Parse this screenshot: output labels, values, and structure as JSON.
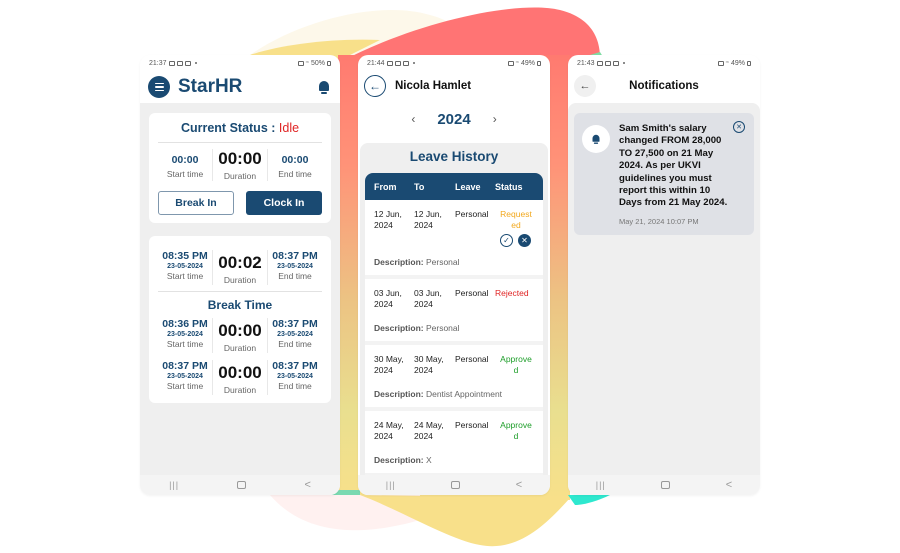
{
  "colors": {
    "brand": "#1a4a72",
    "idle": "#e02424",
    "requested": "#f2a81d",
    "rejected": "#e02424",
    "approved": "#1e9e2a"
  },
  "phone1": {
    "statusbar": {
      "time": "21:37",
      "battery": "50%"
    },
    "app_title": "StarHR",
    "menu_icon": "menu-icon",
    "bell_icon": "bell-icon",
    "current_status": {
      "label": "Current Status : ",
      "value": "Idle"
    },
    "timer": {
      "start_value": "00:00",
      "start_label": "Start time",
      "duration_value": "00:00",
      "duration_label": "Duration",
      "end_value": "00:00",
      "end_label": "End time"
    },
    "buttons": {
      "break_in": "Break In",
      "clock_in": "Clock In"
    },
    "session": {
      "start_time": "08:35 PM",
      "start_date": "23-05-2024",
      "start_label": "Start time",
      "duration": "00:02",
      "duration_label": "Duration",
      "end_time": "08:37 PM",
      "end_date": "23-05-2024",
      "end_label": "End time"
    },
    "break_title": "Break Time",
    "breaks": [
      {
        "start_time": "08:36 PM",
        "start_date": "23-05-2024",
        "start_label": "Start time",
        "duration": "00:00",
        "duration_label": "Duration",
        "end_time": "08:37 PM",
        "end_date": "23-05-2024",
        "end_label": "End time"
      },
      {
        "start_time": "08:37 PM",
        "start_date": "23-05-2024",
        "start_label": "Start time",
        "duration": "00:00",
        "duration_label": "Duration",
        "end_time": "08:37 PM",
        "end_date": "23-05-2024",
        "end_label": "End time"
      }
    ]
  },
  "phone2": {
    "statusbar": {
      "time": "21:44",
      "battery": "49%"
    },
    "employee_name": "Nicola Hamlet",
    "year": "2024",
    "section_title": "Leave History",
    "columns": [
      "From",
      "To",
      "Leave",
      "Status"
    ],
    "description_label": "Description:",
    "rows": [
      {
        "from": [
          "12 Jun,",
          "2024"
        ],
        "to": [
          "12 Jun,",
          "2024"
        ],
        "leave": "Personal",
        "status": [
          "Request",
          "ed"
        ],
        "status_kind": "requested",
        "description": "Personal",
        "actions": true
      },
      {
        "from": [
          "03 Jun,",
          "2024"
        ],
        "to": [
          "03 Jun,",
          "2024"
        ],
        "leave": "Personal",
        "status": [
          "Rejected",
          ""
        ],
        "status_kind": "rejected",
        "description": "Personal",
        "actions": false
      },
      {
        "from": [
          "30 May,",
          "2024"
        ],
        "to": [
          "30 May,",
          "2024"
        ],
        "leave": "Personal",
        "status": [
          "Approve",
          "d"
        ],
        "status_kind": "approved",
        "description": "Dentist Appointment",
        "actions": false
      },
      {
        "from": [
          "24 May,",
          "2024"
        ],
        "to": [
          "24 May,",
          "2024"
        ],
        "leave": "Personal",
        "status": [
          "Approve",
          "d"
        ],
        "status_kind": "approved",
        "description": "X",
        "actions": false
      }
    ]
  },
  "phone3": {
    "statusbar": {
      "time": "21:43",
      "battery": "49%"
    },
    "title": "Notifications",
    "notification": {
      "message": "Sam Smith's salary changed FROM 28,000 TO 27,500 on 21 May 2024. As per UKVI guidelines you must report this within 10 Days from 21 May 2024.",
      "timestamp": "May 21, 2024 10:07 PM"
    }
  },
  "navbar": {
    "recent": "|||",
    "back": "<"
  }
}
